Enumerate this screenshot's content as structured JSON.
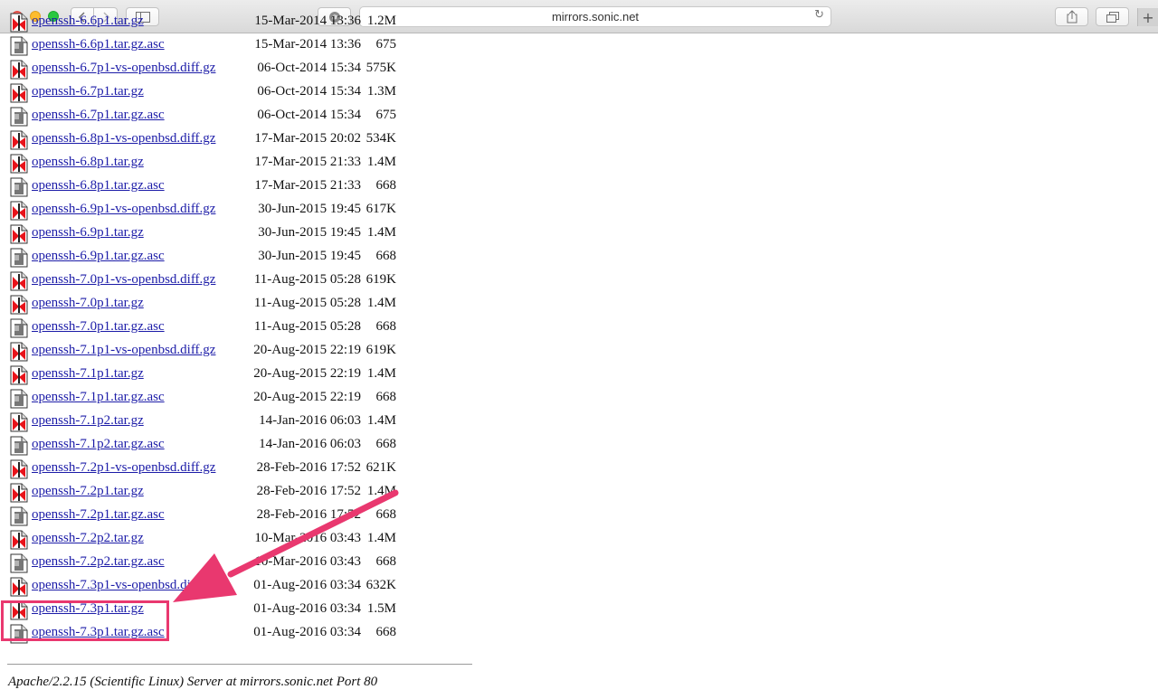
{
  "browser": {
    "url": "mirrors.sonic.net",
    "back_icon": "chevron-left-icon",
    "forward_icon": "chevron-right-icon",
    "new_tab_label": "+"
  },
  "listing": {
    "rows": [
      {
        "name": "openssh-6.6p1.tar.gz",
        "date": "15-Mar-2014 13:36",
        "size": "1.2M",
        "type": "archive"
      },
      {
        "name": "openssh-6.6p1.tar.gz.asc",
        "date": "15-Mar-2014 13:36",
        "size": "675",
        "type": "text"
      },
      {
        "name": "openssh-6.7p1-vs-openbsd.diff.gz",
        "date": "06-Oct-2014 15:34",
        "size": "575K",
        "type": "archive"
      },
      {
        "name": "openssh-6.7p1.tar.gz",
        "date": "06-Oct-2014 15:34",
        "size": "1.3M",
        "type": "archive"
      },
      {
        "name": "openssh-6.7p1.tar.gz.asc",
        "date": "06-Oct-2014 15:34",
        "size": "675",
        "type": "text"
      },
      {
        "name": "openssh-6.8p1-vs-openbsd.diff.gz",
        "date": "17-Mar-2015 20:02",
        "size": "534K",
        "type": "archive"
      },
      {
        "name": "openssh-6.8p1.tar.gz",
        "date": "17-Mar-2015 21:33",
        "size": "1.4M",
        "type": "archive"
      },
      {
        "name": "openssh-6.8p1.tar.gz.asc",
        "date": "17-Mar-2015 21:33",
        "size": "668",
        "type": "text"
      },
      {
        "name": "openssh-6.9p1-vs-openbsd.diff.gz",
        "date": "30-Jun-2015 19:45",
        "size": "617K",
        "type": "archive"
      },
      {
        "name": "openssh-6.9p1.tar.gz",
        "date": "30-Jun-2015 19:45",
        "size": "1.4M",
        "type": "archive"
      },
      {
        "name": "openssh-6.9p1.tar.gz.asc",
        "date": "30-Jun-2015 19:45",
        "size": "668",
        "type": "text"
      },
      {
        "name": "openssh-7.0p1-vs-openbsd.diff.gz",
        "date": "11-Aug-2015 05:28",
        "size": "619K",
        "type": "archive"
      },
      {
        "name": "openssh-7.0p1.tar.gz",
        "date": "11-Aug-2015 05:28",
        "size": "1.4M",
        "type": "archive"
      },
      {
        "name": "openssh-7.0p1.tar.gz.asc",
        "date": "11-Aug-2015 05:28",
        "size": "668",
        "type": "text"
      },
      {
        "name": "openssh-7.1p1-vs-openbsd.diff.gz",
        "date": "20-Aug-2015 22:19",
        "size": "619K",
        "type": "archive"
      },
      {
        "name": "openssh-7.1p1.tar.gz",
        "date": "20-Aug-2015 22:19",
        "size": "1.4M",
        "type": "archive"
      },
      {
        "name": "openssh-7.1p1.tar.gz.asc",
        "date": "20-Aug-2015 22:19",
        "size": "668",
        "type": "text"
      },
      {
        "name": "openssh-7.1p2.tar.gz",
        "date": "14-Jan-2016 06:03",
        "size": "1.4M",
        "type": "archive"
      },
      {
        "name": "openssh-7.1p2.tar.gz.asc",
        "date": "14-Jan-2016 06:03",
        "size": "668",
        "type": "text"
      },
      {
        "name": "openssh-7.2p1-vs-openbsd.diff.gz",
        "date": "28-Feb-2016 17:52",
        "size": "621K",
        "type": "archive"
      },
      {
        "name": "openssh-7.2p1.tar.gz",
        "date": "28-Feb-2016 17:52",
        "size": "1.4M",
        "type": "archive"
      },
      {
        "name": "openssh-7.2p1.tar.gz.asc",
        "date": "28-Feb-2016 17:52",
        "size": "668",
        "type": "text"
      },
      {
        "name": "openssh-7.2p2.tar.gz",
        "date": "10-Mar-2016 03:43",
        "size": "1.4M",
        "type": "archive"
      },
      {
        "name": "openssh-7.2p2.tar.gz.asc",
        "date": "10-Mar-2016 03:43",
        "size": "668",
        "type": "text"
      },
      {
        "name": "openssh-7.3p1-vs-openbsd.diff.gz",
        "date": "01-Aug-2016 03:34",
        "size": "632K",
        "type": "archive"
      },
      {
        "name": "openssh-7.3p1.tar.gz",
        "date": "01-Aug-2016 03:34",
        "size": "1.5M",
        "type": "archive"
      },
      {
        "name": "openssh-7.3p1.tar.gz.asc",
        "date": "01-Aug-2016 03:34",
        "size": "668",
        "type": "text"
      }
    ]
  },
  "footer": {
    "address": "Apache/2.2.15 (Scientific Linux) Server at mirrors.sonic.net Port 80"
  },
  "annotation": {
    "color": "#e9386f",
    "highlighted_file": "openssh-7.3p1.tar.gz"
  }
}
